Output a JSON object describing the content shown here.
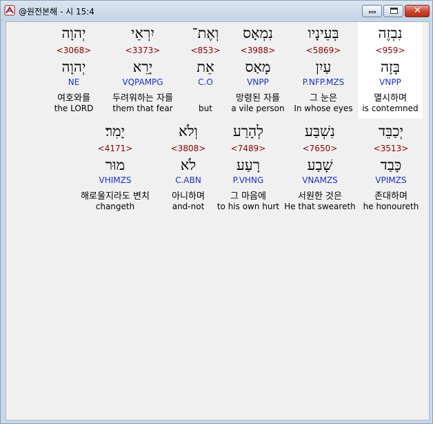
{
  "window": {
    "title": "@원전본해 - 시 15:4",
    "icon": "app-logo-icon",
    "buttons": {
      "minimize": "minimize-icon",
      "maximize": "maximize-icon",
      "close": "close-icon",
      "close_glyph": "✕"
    }
  },
  "row1": [
    {
      "hebrew": "נִבְזֶה",
      "strong": "<959>",
      "lemma": "בָּזָה",
      "parse": "VNPP",
      "korean": "멸시하며",
      "english": "is contemned"
    },
    {
      "hebrew": "בְּעֵינָיו",
      "strong": "<5869>",
      "lemma": "עַיִן",
      "parse": "P.NFP.MZS",
      "korean": "그 눈은",
      "english": "In whose eyes"
    },
    {
      "hebrew": "נִמְאָס",
      "strong": "<3988>",
      "lemma": "מָאַס",
      "parse": "VNPP",
      "korean": "망령된 자를",
      "english": "a vile person"
    },
    {
      "hebrew": "וְאֶת־",
      "strong": "<853>",
      "lemma": "אֵת",
      "parse": "C.O",
      "korean": "",
      "english": "but"
    },
    {
      "hebrew": "יִרְאֵי",
      "strong": "<3373>",
      "lemma": "יָרֵא",
      "parse": "VQPAMPG",
      "korean": "두려워하는 자를",
      "english": "them that fear"
    },
    {
      "hebrew": "יְהוָה",
      "strong": "<3068>",
      "lemma": "יְהוָה",
      "parse": "NE",
      "korean": "여호와를",
      "english": "the LORD"
    }
  ],
  "row2": [
    {
      "hebrew": "יְכַבֵּד",
      "strong": "<3513>",
      "lemma": "כָּבַד",
      "parse": "VPIMZS",
      "korean": "존대하며",
      "english": "he honoureth"
    },
    {
      "hebrew": "נִשְׁבַּע",
      "strong": "<7650>",
      "lemma": "שָׁבַע",
      "parse": "VNAMZS",
      "korean": "서원한 것은",
      "english": "He that sweareth"
    },
    {
      "hebrew": "לְהָרַע",
      "strong": "<7489>",
      "lemma": "רָעַע",
      "parse": "P.VHNG",
      "korean": "그 마음에",
      "english": "to his own hurt"
    },
    {
      "hebrew": "וְלֹא",
      "strong": "<3808>",
      "lemma": "לֹא",
      "parse": "C.ABN",
      "korean": "아니하며",
      "english": "and-not"
    },
    {
      "hebrew": "יָמִר׃",
      "strong": "<4171>",
      "lemma": "מוּר",
      "parse": "VHIMZS",
      "korean": "해로울지라도 변치",
      "english": "changeth"
    }
  ]
}
